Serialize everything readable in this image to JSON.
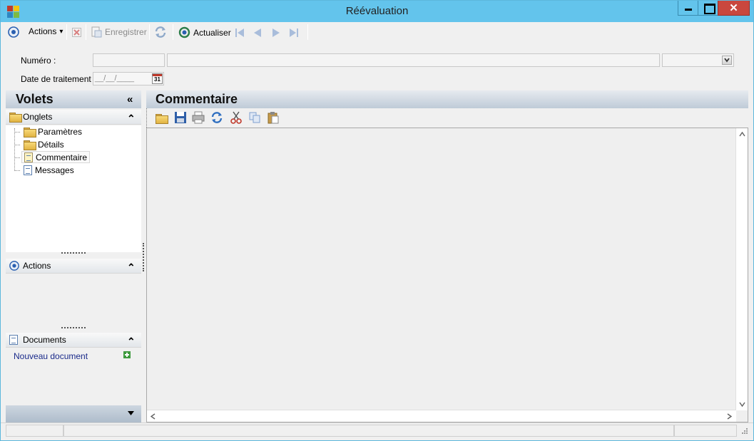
{
  "window": {
    "title": "Réévaluation",
    "close_glyph": "✕"
  },
  "toolbar": {
    "actions_label": "Actions",
    "actions_caret": "▾",
    "save_label": "Enregistrer",
    "refresh_label": "Actualiser"
  },
  "form": {
    "numero_label": "Numéro :",
    "date_label": "Date de traitement :",
    "date_placeholder": "__/__/____",
    "calendar_day": "31"
  },
  "left_panel": {
    "title": "Volets",
    "collapse_glyph": "«",
    "sections": {
      "onglets": {
        "label": "Onglets",
        "items": [
          {
            "label": "Paramètres",
            "icon": "folder-icon"
          },
          {
            "label": "Détails",
            "icon": "folder-icon"
          },
          {
            "label": "Commentaire",
            "icon": "document-icon",
            "selected": true
          },
          {
            "label": "Messages",
            "icon": "document-icon"
          }
        ]
      },
      "actions": {
        "label": "Actions"
      },
      "documents": {
        "label": "Documents",
        "new_document": "Nouveau document"
      }
    },
    "expand_glyph": "⌃"
  },
  "main": {
    "title": "Commentaire"
  }
}
